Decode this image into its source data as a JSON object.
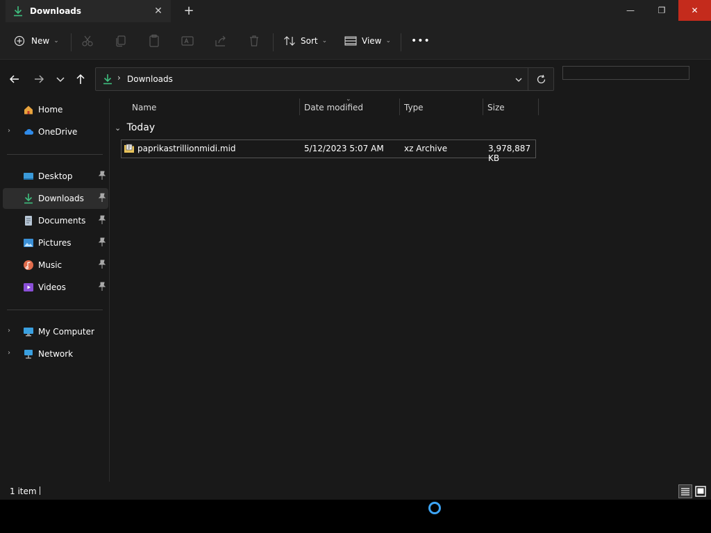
{
  "titlebar": {
    "tab_title": "Downloads",
    "tab_close": "✕",
    "new_tab": "+",
    "minimize": "—",
    "maximize": "❐",
    "close": "✕"
  },
  "toolbar": {
    "new_label": "New",
    "sort_label": "Sort",
    "view_label": "View",
    "more_label": "•••",
    "icons": [
      "plus-circle-icon",
      "cut-icon",
      "copy-icon",
      "paste-icon",
      "rename-icon",
      "share-icon",
      "delete-icon",
      "sort-icon",
      "view-icon",
      "more-icon"
    ]
  },
  "address": {
    "crumb": "Downloads",
    "search_placeholder": ""
  },
  "sidebar": {
    "items": [
      {
        "label": "Home",
        "icon": "home-icon"
      },
      {
        "label": "OneDrive",
        "icon": "cloud-icon"
      },
      {
        "label": "Desktop",
        "icon": "desktop-icon"
      },
      {
        "label": "Downloads",
        "icon": "download-icon"
      },
      {
        "label": "Documents",
        "icon": "document-icon"
      },
      {
        "label": "Pictures",
        "icon": "pictures-icon"
      },
      {
        "label": "Music",
        "icon": "music-icon"
      },
      {
        "label": "Videos",
        "icon": "videos-icon"
      },
      {
        "label": "My Computer",
        "icon": "computer-icon"
      },
      {
        "label": "Network",
        "icon": "network-icon"
      }
    ]
  },
  "columns": {
    "name": "Name",
    "date": "Date modified",
    "type": "Type",
    "size": "Size"
  },
  "group": {
    "label": "Today"
  },
  "files": [
    {
      "name": "paprikastrillionmidi.mid",
      "date": "5/12/2023 5:07 AM",
      "type": "xz Archive",
      "size": "3,978,887 KB"
    }
  ],
  "status": {
    "count": "1 item"
  },
  "colors": {
    "accent_green": "#3fbf7f",
    "close_red": "#c42b1c",
    "spinner_blue": "#3da4f5"
  }
}
